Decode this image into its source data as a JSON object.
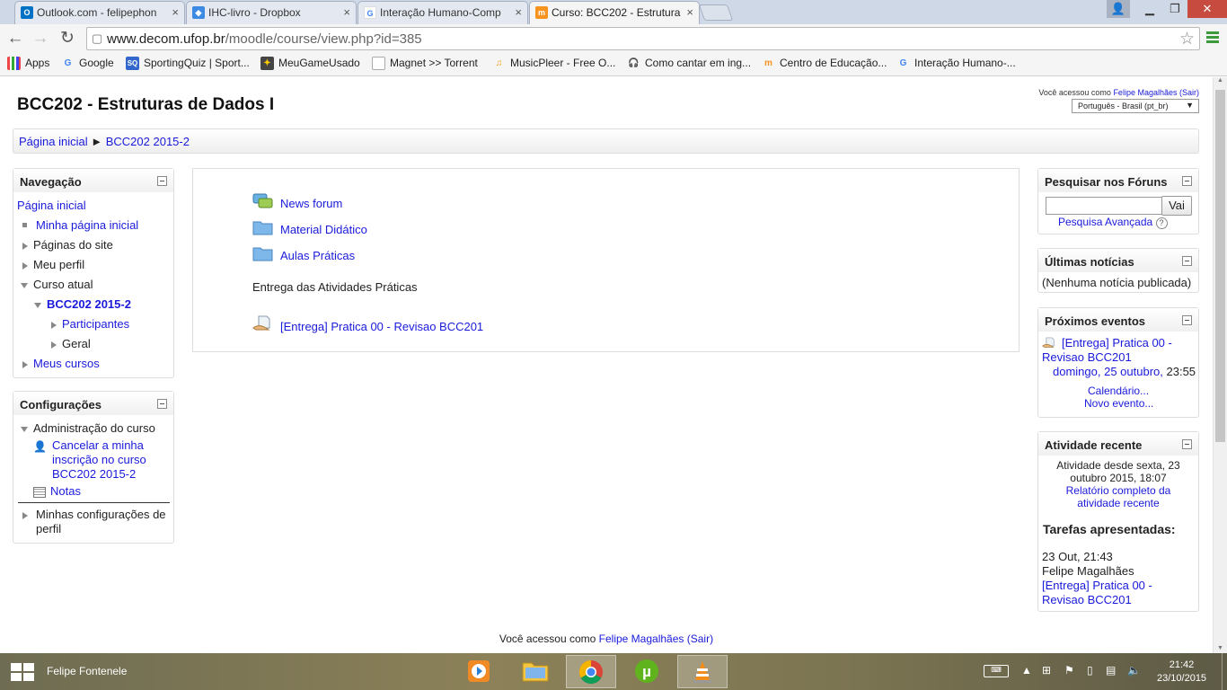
{
  "browser": {
    "tabs": [
      {
        "title": "Outlook.com - felipephon",
        "icon": "outlook-icon"
      },
      {
        "title": "IHC-livro - Dropbox",
        "icon": "dropbox-icon"
      },
      {
        "title": "Interação Humano-Comp",
        "icon": "google-icon"
      },
      {
        "title": "Curso: BCC202 - Estrutura",
        "icon": "moodle-icon"
      }
    ],
    "url_domain": "www.decom.ufop.br",
    "url_path": "/moodle/course/view.php?id=385",
    "bookmarks": [
      {
        "label": "Apps",
        "icon": "apps-grid-icon"
      },
      {
        "label": "Google",
        "icon": "google-icon"
      },
      {
        "label": "SportingQuiz | Sport...",
        "icon": "sportingquiz-icon"
      },
      {
        "label": "MeuGameUsado",
        "icon": "meugameusado-icon"
      },
      {
        "label": "Magnet >> Torrent",
        "icon": "page-icon"
      },
      {
        "label": "MusicPleer - Free O...",
        "icon": "musicpleer-icon"
      },
      {
        "label": "Como cantar em ing...",
        "icon": "headphones-icon"
      },
      {
        "label": "Centro de Educação...",
        "icon": "moodle-icon"
      },
      {
        "label": "Interação Humano-...",
        "icon": "google-icon"
      }
    ]
  },
  "header": {
    "course_title": "BCC202 - Estruturas de Dados I",
    "login_prefix": "Você acessou como",
    "user_name": "Felipe Magalhães",
    "logout": "(Sair)",
    "language": "Português - Brasil (pt_br)"
  },
  "breadcrumb": {
    "home": "Página inicial",
    "separator": "►",
    "course": "BCC202 2015-2"
  },
  "navigation": {
    "title": "Navegação",
    "home": "Página inicial",
    "my_home": "Minha página inicial",
    "site_pages": "Páginas do site",
    "my_profile": "Meu perfil",
    "current_course": "Curso atual",
    "course": "BCC202 2015-2",
    "participants": "Participantes",
    "general": "Geral",
    "my_courses": "Meus cursos"
  },
  "settings": {
    "title": "Configurações",
    "course_admin": "Administração do curso",
    "unenrol_line1": "Cancelar a minha",
    "unenrol_line2": "inscrição no curso",
    "unenrol_line3": "BCC202 2015-2",
    "grades": "Notas",
    "profile_settings_line1": "Minhas configurações de",
    "profile_settings_line2": "perfil"
  },
  "course_content": {
    "activities": [
      {
        "label": "News forum",
        "icon": "forum-icon"
      },
      {
        "label": "Material Didático",
        "icon": "folder-icon"
      },
      {
        "label": "Aulas Práticas",
        "icon": "folder-icon"
      }
    ],
    "label_text": "Entrega das Atividades Práticas",
    "assignment": "[Entrega] Pratica 00 - Revisao BCC201"
  },
  "search_forums": {
    "title": "Pesquisar nos Fóruns",
    "input_value": "",
    "button": "Vai",
    "advanced": "Pesquisa Avançada"
  },
  "latest_news": {
    "title": "Últimas notícias",
    "empty": "(Nenhuma notícia publicada)"
  },
  "upcoming_events": {
    "title": "Próximos eventos",
    "event_line1": "[Entrega] Pratica 00 -",
    "event_line2": "Revisao BCC201",
    "event_date": "domingo, 25 outubro,",
    "event_time": "23:55",
    "calendar": "Calendário...",
    "new_event": "Novo evento..."
  },
  "recent_activity": {
    "title": "Atividade recente",
    "since_line1": "Atividade desde sexta, 23",
    "since_line2": "outubro 2015, 18:07",
    "report_line1": "Relatório completo da",
    "report_line2": "atividade recente",
    "submitted_title": "Tarefas apresentadas:",
    "submission_time": "23 Out, 21:43",
    "submission_user": "Felipe Magalhães",
    "submission_line1": "[Entrega] Pratica 00 -",
    "submission_line2": "Revisao BCC201"
  },
  "footer": {
    "login_prefix": "Você acessou como",
    "user_name": "Felipe Magalhães",
    "logout": "(Sair)"
  },
  "taskbar": {
    "user": "Felipe Fontenele",
    "apps": [
      "media-player-icon",
      "file-explorer-icon",
      "chrome-icon",
      "utorrent-icon",
      "vlc-icon"
    ],
    "time": "21:42",
    "date": "23/10/2015"
  },
  "colors": {
    "link": "#1a1adb",
    "taskbar": "#7b7452",
    "tab_strip": "#cfd8e6"
  }
}
